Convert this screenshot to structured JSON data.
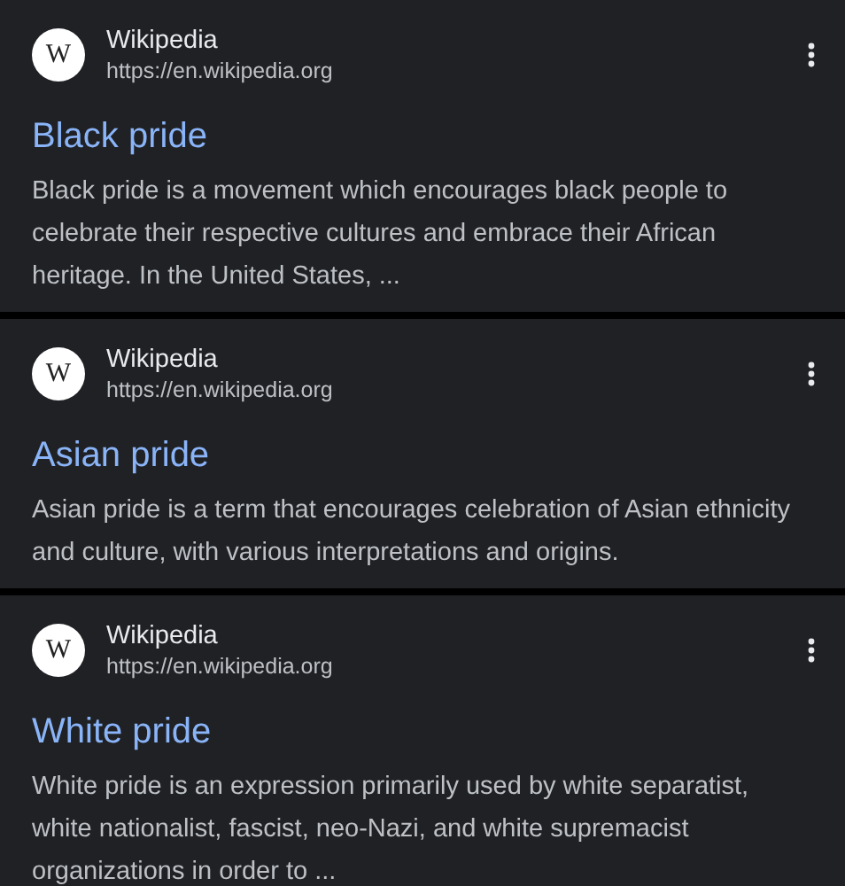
{
  "results": [
    {
      "favicon": "W",
      "site": "Wikipedia",
      "url": "https://en.wikipedia.org",
      "title": "Black pride",
      "snippet": "Black pride is a movement which encourages black people to celebrate their respective cultures and embrace their African heritage. In the United States, ..."
    },
    {
      "favicon": "W",
      "site": "Wikipedia",
      "url": "https://en.wikipedia.org",
      "title": "Asian pride",
      "snippet": "Asian pride is a term that encourages celebration of Asian ethnicity and culture, with various interpretations and origins."
    },
    {
      "favicon": "W",
      "site": "Wikipedia",
      "url": "https://en.wikipedia.org",
      "title": "White pride",
      "snippet": "White pride is an expression primarily used by white separatist, white nationalist, fascist, neo-Nazi, and white supremacist organizations in order to ..."
    }
  ]
}
